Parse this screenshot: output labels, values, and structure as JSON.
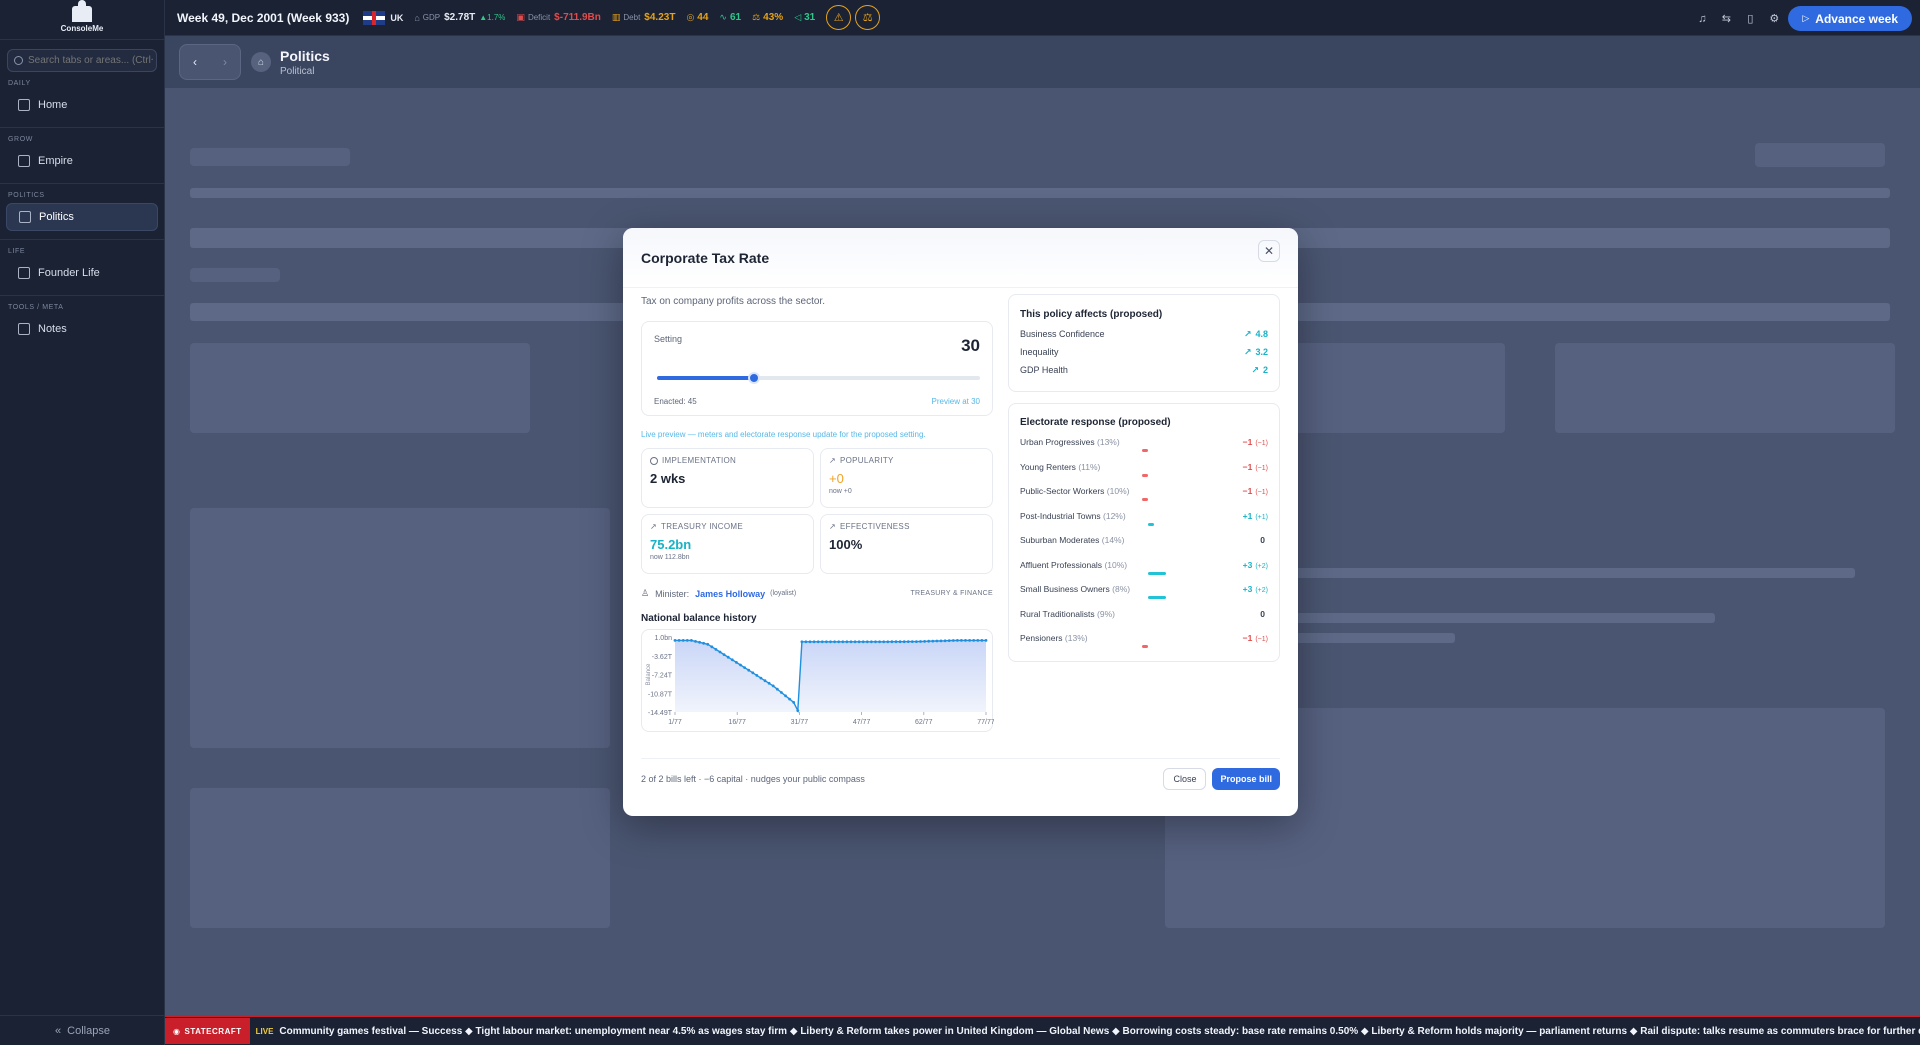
{
  "app": {
    "logo_text": "ConsoleMe"
  },
  "sidebar": {
    "search_placeholder": "Search tabs or areas... (Ctrl+K)",
    "sections": [
      {
        "label": "DAILY",
        "item": "Home"
      },
      {
        "label": "GROW",
        "item": "Empire"
      },
      {
        "label": "POLITICS",
        "item": "Politics"
      },
      {
        "label": "LIFE",
        "item": "Founder Life"
      },
      {
        "label": "TOOLS / META",
        "item": "Notes"
      }
    ],
    "collapse_label": "Collapse"
  },
  "topbar": {
    "week": "Week 49, Dec 2001 (Week 933)",
    "country": "UK",
    "gdp_label": "GDP",
    "gdp_value": "$2.78T",
    "gdp_change": "▲1.7%",
    "deficit_label": "Deficit",
    "deficit_value": "$-711.9Bn",
    "debt_label": "Debt",
    "debt_value": "$4.23T",
    "stat1": "44",
    "stat2": "61",
    "stat3": "43%",
    "stat4": "31",
    "advance_label": "Advance week",
    "colors": {
      "accent": "#2f6ae0",
      "warning": "#e6a21a",
      "negative": "#e24b4b",
      "positive": "#2fc88a"
    }
  },
  "page": {
    "title": "Politics",
    "subtitle": "Political"
  },
  "modal": {
    "title": "Corporate Tax Rate",
    "description": "Tax on company profits across the sector.",
    "setting": {
      "label": "Setting",
      "value": "30",
      "min": 0,
      "max": 100,
      "level": 30,
      "enacted": "Enacted: 45",
      "preview": "Preview at 30"
    },
    "live_note": "Live preview — meters and electorate response update for the proposed setting.",
    "metrics": [
      {
        "label": "IMPLEMENTATION",
        "value": "2 wks",
        "note": "",
        "icon": "clock-icon",
        "color": "#1d2433"
      },
      {
        "label": "POPULARITY",
        "value": "+0",
        "note": "now +0",
        "icon": "trend-icon",
        "color": "#f0a326"
      },
      {
        "label": "TREASURY INCOME",
        "value": "75.2bn",
        "note": "now 112.8bn",
        "icon": "trend-icon",
        "color": "#17b2c6"
      },
      {
        "label": "EFFECTIVENESS",
        "value": "100%",
        "note": "",
        "icon": "trend-icon",
        "color": "#1d2433"
      }
    ],
    "minister": {
      "label": "Minister:",
      "name": "James Holloway",
      "tag": "(loyalist)",
      "dept": "TREASURY & FINANCE"
    },
    "history_title": "National balance history",
    "footer_text": "2 of 2 bills left · −6 capital · nudges your public compass",
    "close_label": "Close",
    "propose_label": "Propose bill",
    "affects": {
      "title": "This policy affects (proposed)",
      "rows": [
        {
          "name": "Business Confidence",
          "value": "4.8"
        },
        {
          "name": "Inequality",
          "value": "3.2"
        },
        {
          "name": "GDP Health",
          "value": "2"
        }
      ]
    },
    "electorate": {
      "title": "Electorate response (proposed)",
      "rows": [
        {
          "name": "Urban Progressives",
          "pct": "(13%)",
          "value": "−1",
          "delta": "(−1)",
          "n": -1
        },
        {
          "name": "Young Renters",
          "pct": "(11%)",
          "value": "−1",
          "delta": "(−1)",
          "n": -1
        },
        {
          "name": "Public-Sector Workers",
          "pct": "(10%)",
          "value": "−1",
          "delta": "(−1)",
          "n": -1
        },
        {
          "name": "Post-Industrial Towns",
          "pct": "(12%)",
          "value": "+1",
          "delta": "(+1)",
          "n": 1
        },
        {
          "name": "Suburban Moderates",
          "pct": "(14%)",
          "value": "0",
          "delta": "",
          "n": 0
        },
        {
          "name": "Affluent Professionals",
          "pct": "(10%)",
          "value": "+3",
          "delta": "(+2)",
          "n": 3
        },
        {
          "name": "Small Business Owners",
          "pct": "(8%)",
          "value": "+3",
          "delta": "(+2)",
          "n": 3
        },
        {
          "name": "Rural Traditionalists",
          "pct": "(9%)",
          "value": "0",
          "delta": "",
          "n": 0
        },
        {
          "name": "Pensioners",
          "pct": "(13%)",
          "value": "−1",
          "delta": "(−1)",
          "n": -1
        }
      ]
    }
  },
  "chart_data": {
    "type": "area",
    "title": "National balance history",
    "ylabel": "Balance",
    "y_tick_labels": [
      "1.0bn",
      "-3.62T",
      "-7.24T",
      "-10.87T",
      "-14.49T"
    ],
    "x_tick_labels": [
      "1/77",
      "16/77",
      "31/77",
      "47/77",
      "62/77",
      "77/77"
    ],
    "ylim": [
      -14.49,
      1.0
    ],
    "series": [
      {
        "x": [
          1,
          5,
          9,
          15,
          20,
          25,
          30,
          31,
          32,
          40,
          50,
          60,
          70,
          77
        ],
        "values": [
          0.3,
          0.3,
          -0.5,
          -3.7,
          -6.4,
          -9.1,
          -12.5,
          -14.2,
          0.0,
          0.0,
          0.0,
          0.05,
          0.3,
          0.3
        ]
      }
    ]
  },
  "ticker": {
    "brand": "STATECRAFT",
    "live": "LIVE",
    "text": "Community games festival — Success ◆ Tight labour market: unemployment near 4.5% as wages stay firm ◆ Liberty & Reform takes power in United Kingdom — Global News ◆ Borrowing costs steady: base rate remains 0.50% ◆ Liberty & Reform holds majority — parliament returns ◆ Rail dispute: talks resume as commuters brace for further disruption ◆ Techre"
  }
}
